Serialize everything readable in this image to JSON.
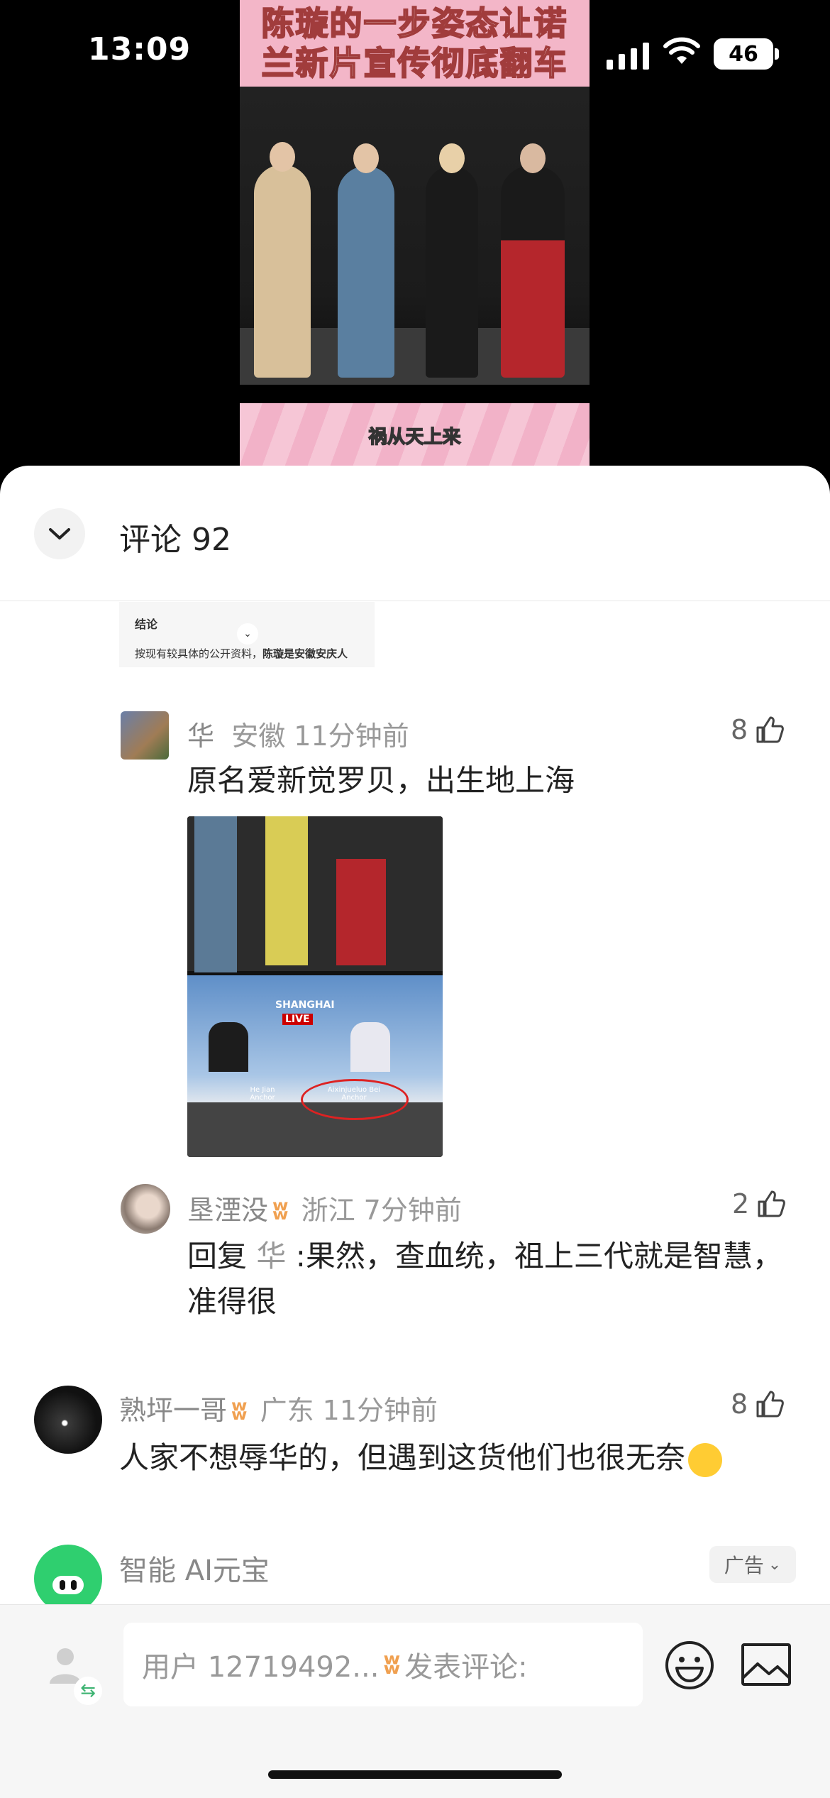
{
  "status_bar": {
    "time": "13:09",
    "battery": "46"
  },
  "video": {
    "title_line1": "陈璇的一步姿态让诺",
    "title_line2": "兰新片宣传彻底翻车",
    "subtitle": "祸从天上来"
  },
  "sheet": {
    "title": "评论 92"
  },
  "snippet": {
    "heading": "结论",
    "text_prefix": "按现有较具体的公开资料，",
    "text_bold": "陈璇是安徽安庆人"
  },
  "comments": [
    {
      "user": "华",
      "location": "安徽",
      "time": "11分钟前",
      "likes": "8",
      "text": "原名爱新觉罗贝，出生地上海",
      "image": {
        "banner": "SHANGHAI",
        "live": "LIVE",
        "name1": "He Jian",
        "role1": "Anchor",
        "name2": "Aixinjueluo Bei",
        "role2": "Anchor"
      }
    },
    {
      "user": "垦湮没",
      "location": "浙江",
      "time": "7分钟前",
      "likes": "2",
      "reply_prefix": "回复",
      "reply_to": "华",
      "text": ":果然，查血统，祖上三代就是智慧，准得很"
    },
    {
      "user": "熟坪一哥",
      "location": "广东",
      "time": "11分钟前",
      "likes": "8",
      "text": "人家不想辱华的，但遇到这货他们也很无奈"
    }
  ],
  "ad": {
    "name": "智能 AI元宝",
    "tag": "广告"
  },
  "bottom_bar": {
    "placeholder_user": "用户 12719492...",
    "placeholder_action": "发表评论:"
  },
  "icons": [
    "chevron-down-icon",
    "thumb-up-icon",
    "vip-icon",
    "emoji-icon",
    "image-icon",
    "user-avatar-icon",
    "wifi-icon",
    "signal-icon"
  ]
}
